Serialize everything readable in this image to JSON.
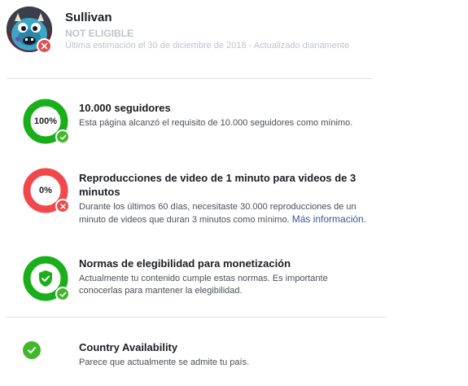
{
  "header": {
    "page_name": "Sullivan",
    "eligibility_status": "NOT ELIGIBLE",
    "estimate_text": "Última estimación el 30 de diciembre de 2018 - Actualizado diariamente"
  },
  "requirements": [
    {
      "title": "10.000 seguidores",
      "description": "Esta página alcanzó el requisito de 10.000 seguidores como mínimo.",
      "progress_label": "100%",
      "progress": 1.0,
      "status": "met",
      "ring_color": "#1aaf1a"
    },
    {
      "title": "Reproducciones de video de 1 minuto para videos de 3 minutos",
      "description": "Durante los últimos 60 días, necesitaste 30.000 reproducciones de un minuto de videos que duran 3 minutos como mínimo.",
      "link_text": "Más información.",
      "progress_label": "0%",
      "progress": 0.0,
      "status": "not-met",
      "ring_color": "#f0484d"
    },
    {
      "title": "Normas de elegibilidad para monetización",
      "description": "Actualmente tu contenido cumple estas normas. Es importante conocerlas para mantener la elegibilidad.",
      "status": "met",
      "icon": "shield-check-icon",
      "ring_color": "#1aaf1a"
    },
    {
      "title": "Country Availability",
      "description": "Parece que actualmente se admite tu país.",
      "status": "met",
      "icon": "check-icon"
    }
  ],
  "colors": {
    "green": "#42b72a",
    "red": "#e74c4c",
    "muted": "#bec3c9",
    "link": "#365899"
  }
}
